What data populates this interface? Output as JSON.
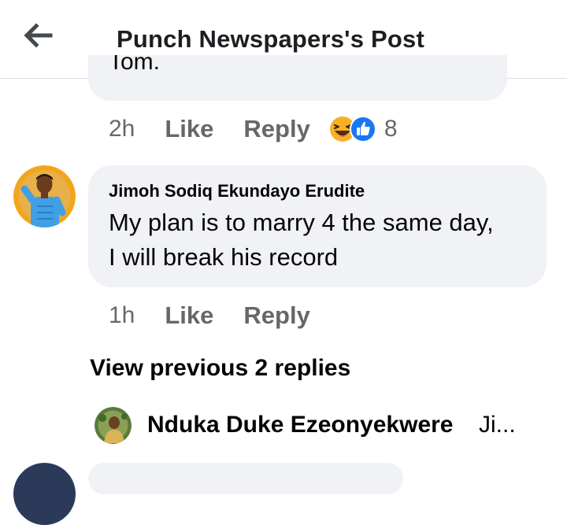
{
  "header": {
    "back_icon": "arrow-left-icon",
    "title": "Punch Newspapers's Post"
  },
  "previous_comment": {
    "text_fragment": "Tom.",
    "time": "2h",
    "like_label": "Like",
    "reply_label": "Reply",
    "reactions": [
      "haha-icon",
      "like-icon"
    ],
    "reaction_count": "8"
  },
  "comment": {
    "author": "Jimoh Sodiq Ekundayo Erudite",
    "text_lines": [
      "My plan is to marry 4 the same day,",
      "I will break his record"
    ],
    "time": "1h",
    "like_label": "Like",
    "reply_label": "Reply"
  },
  "view_previous_replies": "View previous 2 replies",
  "reply_preview": {
    "author": "Nduka Duke Ezeonyekwere",
    "snippet": "Ji..."
  },
  "colors": {
    "bubble": "#f0f2f5",
    "meta": "#65676b",
    "like_blue": "#1877f2",
    "haha_yellow": "#f7b125"
  }
}
